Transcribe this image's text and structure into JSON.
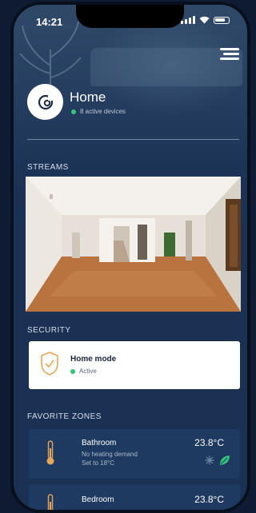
{
  "status_bar": {
    "time": "14:21"
  },
  "home": {
    "title": "Home",
    "active_devices": "8 active devices"
  },
  "sections": {
    "streams": "STREAMS",
    "security": "SECURITY",
    "favorite_zones": "FAVORITE ZONES"
  },
  "security": {
    "mode_title": "Home mode",
    "status": "Active"
  },
  "zones": [
    {
      "name": "Bathroom",
      "line1": "No heating demand",
      "line2": "Set to 18°C",
      "temperature": "23.8°C"
    },
    {
      "name": "Bedroom",
      "temperature": "23.8°C"
    }
  ],
  "colors": {
    "accent_green": "#34c37a",
    "security_shield": "#e7a75a",
    "panel": "#1e3a60"
  }
}
